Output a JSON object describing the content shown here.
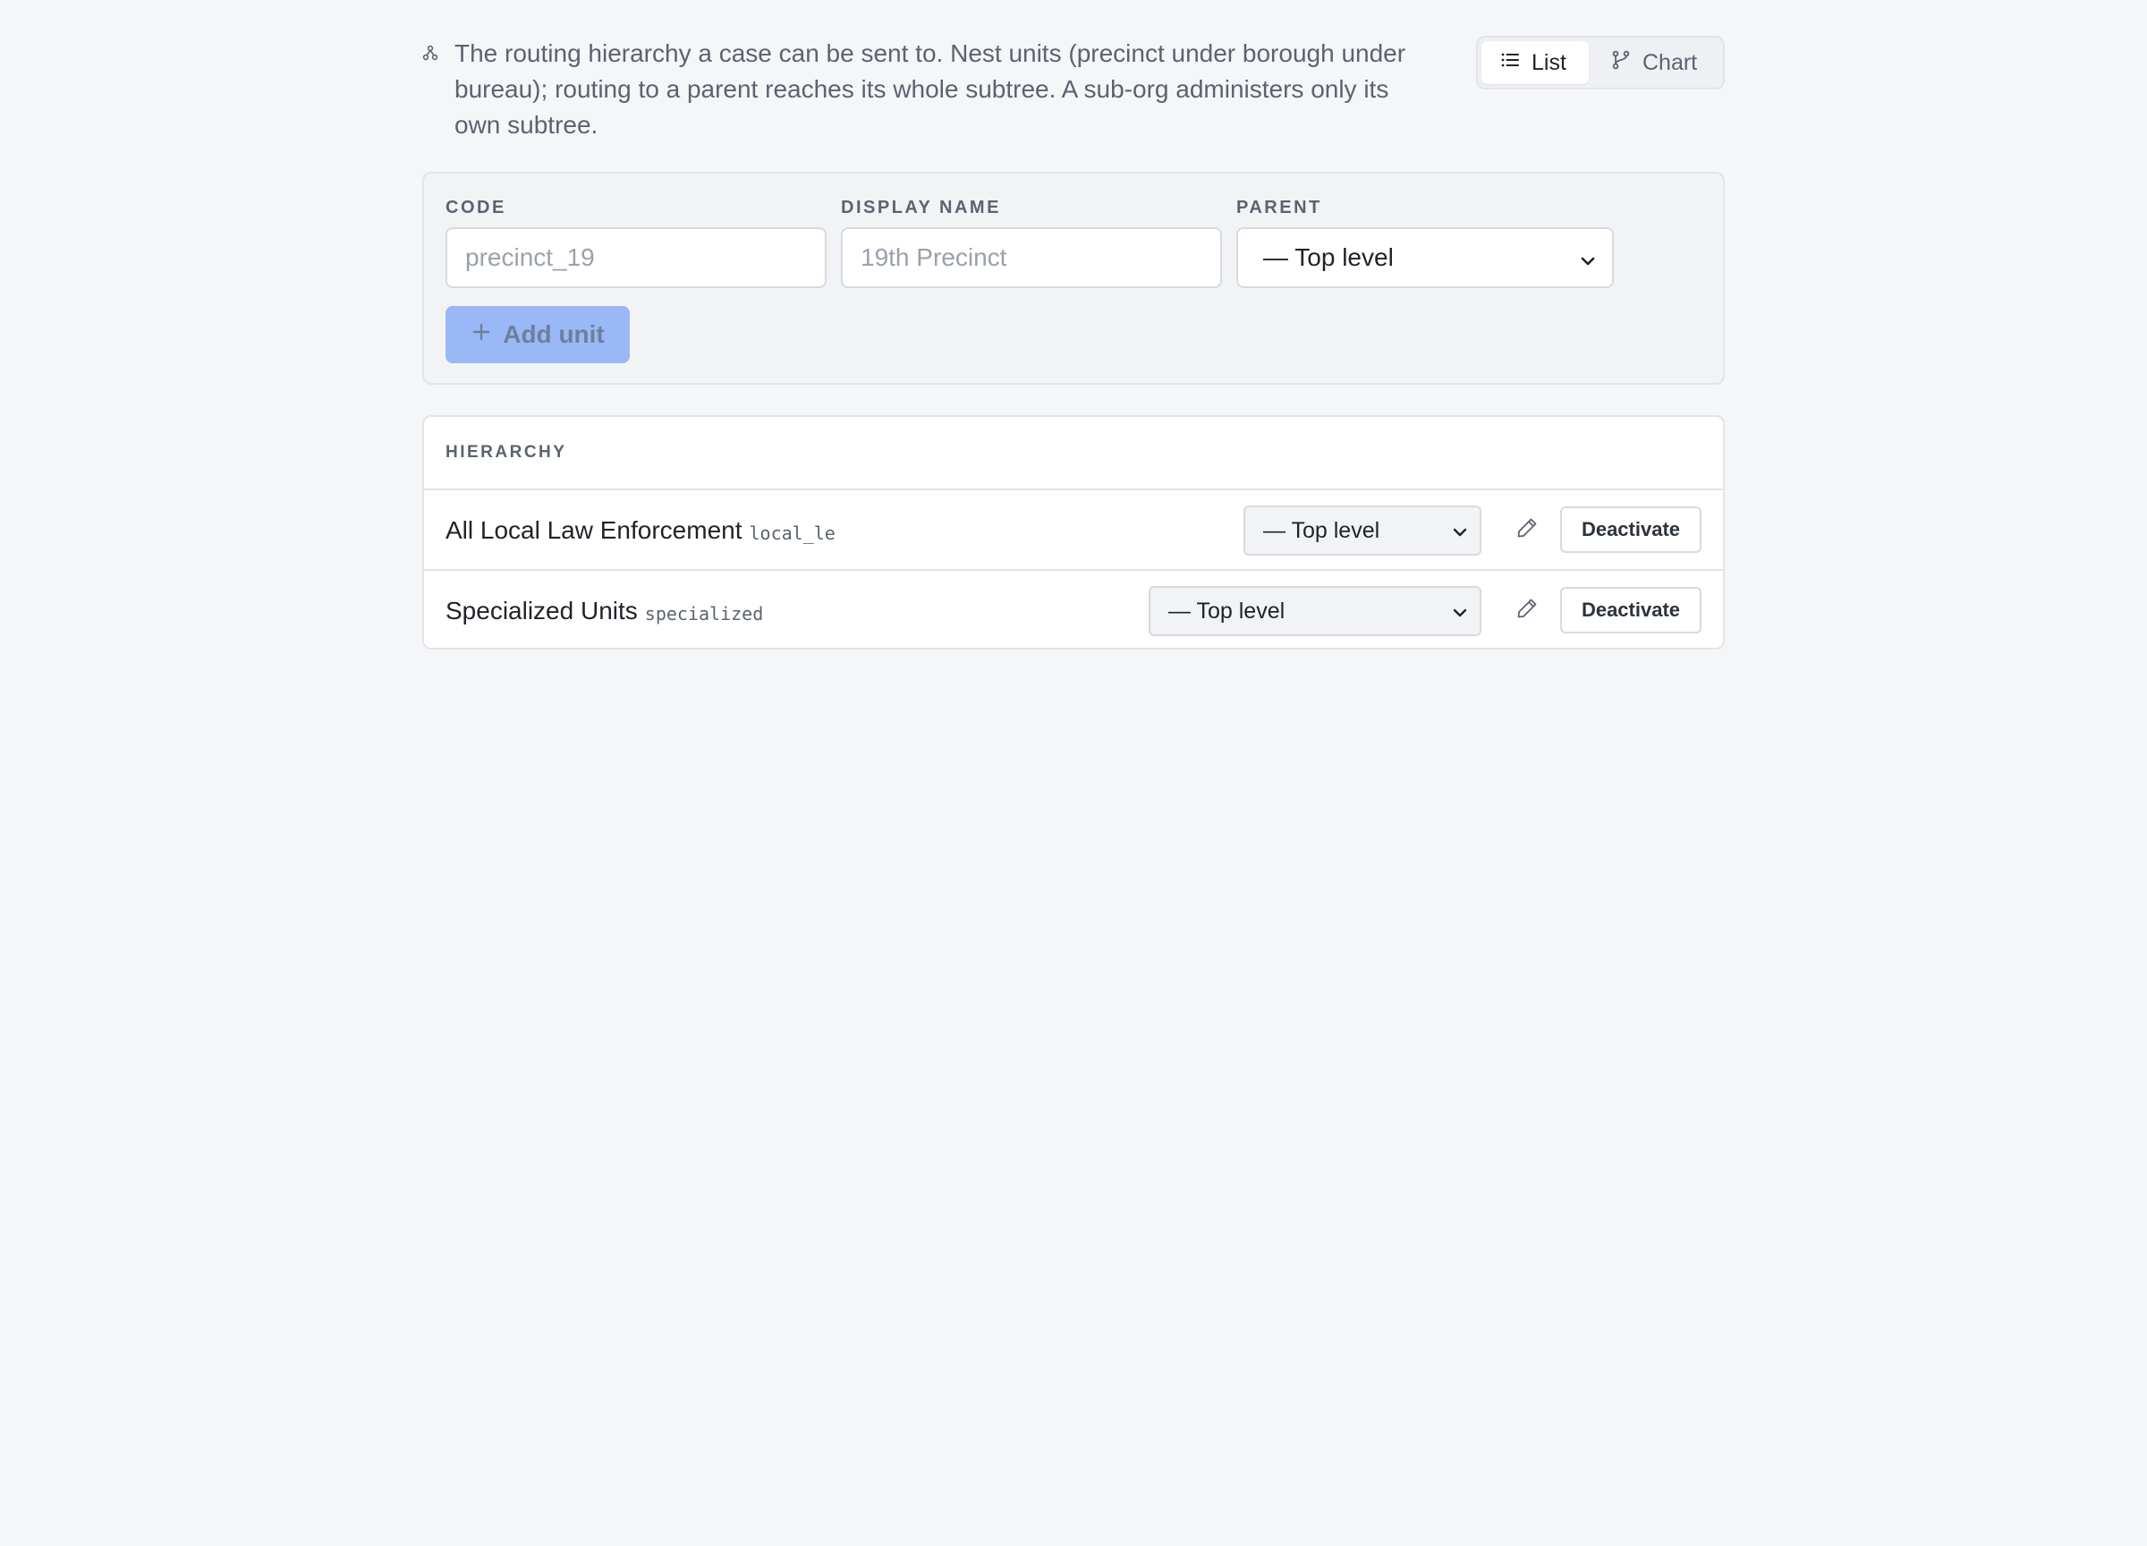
{
  "intro": {
    "icon": "hierarchy-icon",
    "text": "The routing hierarchy a case can be sent to. Nest units (precinct under borough under bureau); routing to a parent reaches its whole subtree. A sub-org administers only its own subtree."
  },
  "view_toggle": {
    "list_label": "List",
    "list_icon": "list-icon",
    "chart_label": "Chart",
    "chart_icon": "branch-icon",
    "active": "List"
  },
  "add_form": {
    "code_label": "CODE",
    "code_placeholder": "precinct_19",
    "code_value": "",
    "name_label": "DISPLAY NAME",
    "name_placeholder": "19th Precinct",
    "name_value": "",
    "parent_label": "PARENT",
    "parent_value": "— Top level",
    "add_button_label": "Add unit",
    "add_button_icon": "plus-icon"
  },
  "hierarchy": {
    "header": "HIERARCHY",
    "rows": [
      {
        "name": "All Local Law Enforcement",
        "code": "local_le",
        "parent": "— Top level",
        "edit_icon": "pencil-icon",
        "action_label": "Deactivate"
      },
      {
        "name": "Specialized Units",
        "code": "specialized",
        "parent": "— Top level",
        "edit_icon": "pencil-icon",
        "action_label": "Deactivate"
      }
    ]
  },
  "colors": {
    "background": "#f5f6f8",
    "primary_disabled": "#9ab8f5",
    "border": "#e1e4e8",
    "muted_text": "#5b6370"
  }
}
